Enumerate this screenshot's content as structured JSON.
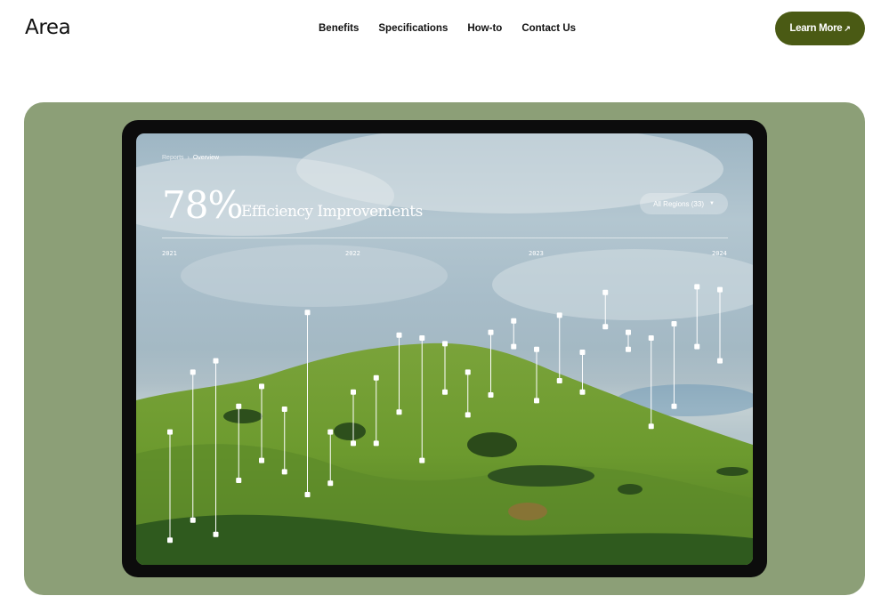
{
  "brand": "Area",
  "nav": {
    "items": [
      "Benefits",
      "Specifications",
      "How-to",
      "Contact Us"
    ]
  },
  "cta": {
    "label": "Learn More",
    "icon": "arrow-up-right-icon"
  },
  "colors": {
    "accent": "#4a5a14",
    "hero_bg": "#8c9f77",
    "tablet_frame": "#0c0c0c"
  },
  "dashboard": {
    "breadcrumb": [
      "Reports",
      "Overview"
    ],
    "breadcrumb_separator": "›",
    "metric": "78%",
    "metric_label": "Efficiency Improvements",
    "region_filter": "All Regions (33)",
    "years": [
      "2021",
      "2022",
      "2023",
      "2024"
    ],
    "range_pairs": [
      [
        0.42,
        0.04
      ],
      [
        0.63,
        0.11
      ],
      [
        0.67,
        0.06
      ],
      [
        0.51,
        0.25
      ],
      [
        0.58,
        0.32
      ],
      [
        0.5,
        0.28
      ],
      [
        0.84,
        0.2
      ],
      [
        0.42,
        0.24
      ],
      [
        0.56,
        0.38
      ],
      [
        0.61,
        0.38
      ],
      [
        0.76,
        0.49
      ],
      [
        0.75,
        0.32
      ],
      [
        0.73,
        0.56
      ],
      [
        0.63,
        0.48
      ],
      [
        0.77,
        0.55
      ],
      [
        0.81,
        0.72
      ],
      [
        0.71,
        0.53
      ],
      [
        0.83,
        0.6
      ],
      [
        0.7,
        0.56
      ],
      [
        0.91,
        0.79
      ],
      [
        0.77,
        0.71
      ],
      [
        0.75,
        0.44
      ],
      [
        0.8,
        0.51
      ],
      [
        0.93,
        0.72
      ],
      [
        0.92,
        0.67
      ]
    ]
  }
}
